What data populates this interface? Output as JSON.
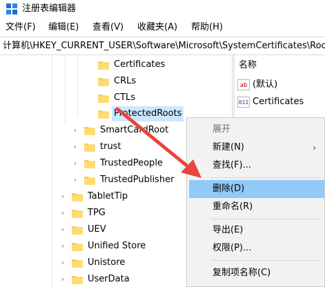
{
  "window": {
    "title": "注册表编辑器",
    "icon": "registry-editor-icon"
  },
  "menu": [
    "文件(F)",
    "编辑(E)",
    "查看(V)",
    "收藏夹(A)",
    "帮助(H)"
  ],
  "address": "计算机\\HKEY_CURRENT_USER\\Software\\Microsoft\\SystemCertificates\\Root",
  "tree": {
    "children_of_root": [
      "Certificates",
      "CRLs",
      "CTLs",
      "ProtectedRoots"
    ],
    "selected": "ProtectedRoots",
    "cert_stores": [
      "SmartCardRoot",
      "trust",
      "TrustedPeople",
      "TrustedPublisher"
    ],
    "software_keys": [
      "TabletTip",
      "TPG",
      "UEV",
      "Unified Store",
      "Unistore",
      "UserData"
    ]
  },
  "values_pane": {
    "column_name": "名称",
    "rows": [
      {
        "icon": "string-value-icon",
        "icon_text": "ab",
        "name": "(默认)"
      },
      {
        "icon": "binary-value-icon",
        "icon_text": "011",
        "name": "Certificates"
      }
    ]
  },
  "context_menu": {
    "header": "展开",
    "new": "新建(N)",
    "find": "查找(F)...",
    "delete": "删除(D)",
    "rename": "重命名(R)",
    "export": "导出(E)",
    "permissions": "权限(P)...",
    "copy_key_name": "复制项名称(C)",
    "submenu_arrow": "›",
    "highlighted": "删除(D)"
  },
  "annotation": {
    "color": "#e8463c"
  },
  "colors": {
    "selection": "#cce8ff",
    "menu_highlight": "#91c9f7",
    "folder": "#f6cd5a"
  }
}
